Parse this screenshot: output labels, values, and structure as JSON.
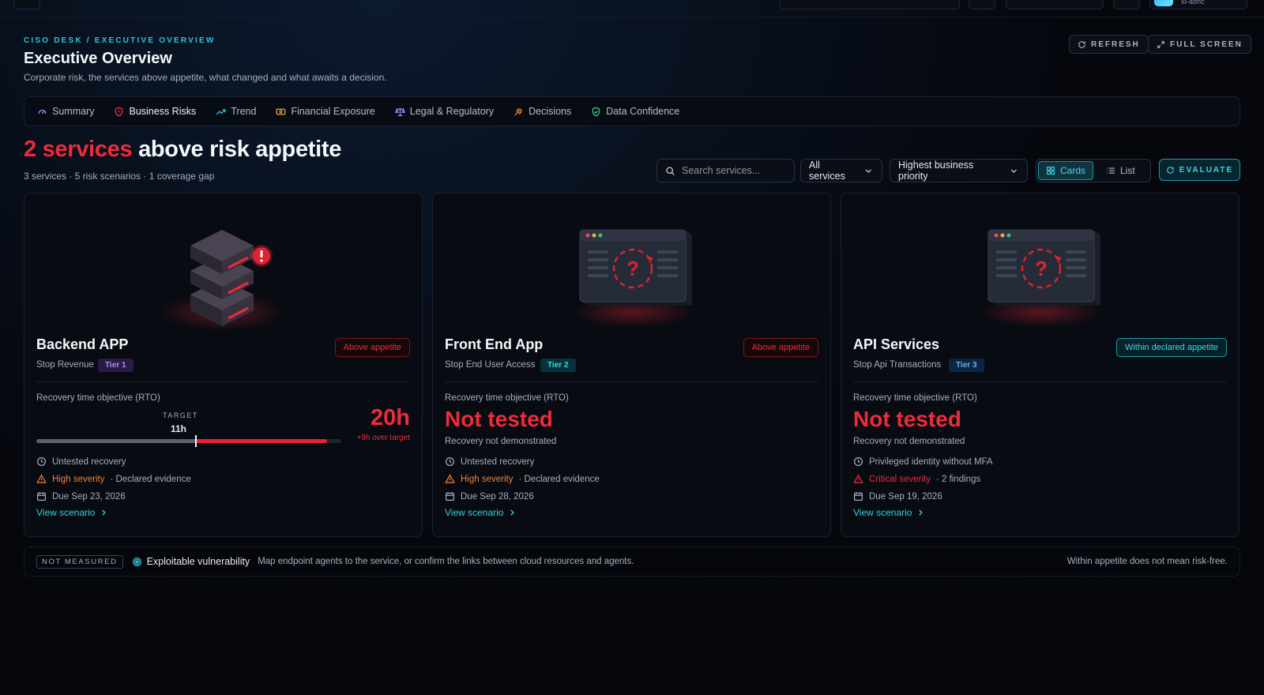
{
  "app": {
    "user_label": "xFabric"
  },
  "header": {
    "breadcrumb": "CISO DESK / EXECUTIVE OVERVIEW",
    "title": "Executive Overview",
    "subtitle": "Corporate risk, the services above appetite, what changed and what awaits a decision.",
    "refresh_label": "REFRESH",
    "fullscreen_label": "FULL SCREEN"
  },
  "tabs": [
    {
      "label": "Summary",
      "icon": "gauge-icon",
      "active": false
    },
    {
      "label": "Business Risks",
      "icon": "shield-alert-icon",
      "active": true
    },
    {
      "label": "Trend",
      "icon": "trend-up-icon",
      "active": false
    },
    {
      "label": "Financial Exposure",
      "icon": "banknote-icon",
      "active": false
    },
    {
      "label": "Legal & Regulatory",
      "icon": "scale-icon",
      "active": false
    },
    {
      "label": "Decisions",
      "icon": "gavel-icon",
      "active": false
    },
    {
      "label": "Data Confidence",
      "icon": "shield-check-icon",
      "active": false
    }
  ],
  "summary": {
    "headline_count": "2 services",
    "headline_rest": " above risk appetite",
    "subline": "3 services · 5 risk scenarios · 1 coverage gap"
  },
  "controls": {
    "search_placeholder": "Search services...",
    "filter_value": "All services",
    "sort_value": "Highest business priority",
    "view_cards": "Cards",
    "view_list": "List",
    "view_selected": "Cards",
    "evaluate_label": "EVALUATE"
  },
  "cards": [
    {
      "name": "Backend APP",
      "impact": "Stop Revenue",
      "tier": "Tier 1",
      "status": "Above appetite",
      "rto_label": "Recovery time objective (RTO)",
      "rto_target_label": "TARGET",
      "rto_target": "11h",
      "rto_value": "20h",
      "rto_over": "+9h over target",
      "rto_target_hours": 11,
      "rto_value_hours": 20,
      "meta1": "Untested recovery",
      "severity": "High severity",
      "severity_detail": "· Declared evidence",
      "due": "Due Sep 23, 2026",
      "link": "View scenario"
    },
    {
      "name": "Front End App",
      "impact": "Stop End User Access",
      "tier": "Tier 2",
      "status": "Above appetite",
      "rto_label": "Recovery time objective (RTO)",
      "rto_status": "Not tested",
      "rto_sub": "Recovery not demonstrated",
      "meta1": "Untested recovery",
      "severity": "High severity",
      "severity_detail": "· Declared evidence",
      "due": "Due Sep 28, 2026",
      "link": "View scenario"
    },
    {
      "name": "API Services",
      "impact": "Stop Api Transactions",
      "tier": "Tier 3",
      "status": "Within declared appetite",
      "rto_label": "Recovery time objective (RTO)",
      "rto_status": "Not tested",
      "rto_sub": "Recovery not demonstrated",
      "meta1": "Privileged identity without MFA",
      "severity": "Critical severity",
      "severity_detail": "· 2 findings",
      "due": "Due Sep 19, 2026",
      "link": "View scenario"
    }
  ],
  "coverage": {
    "tag": "NOT MEASURED",
    "name": "Exploitable vulnerability",
    "text": "Map endpoint agents to the service, or confirm the links between cloud resources and agents.",
    "note": "Within appetite does not mean risk-free."
  },
  "colors": {
    "accent": "#2ec5d6",
    "danger": "#ef2b3a",
    "warning": "#f2813a",
    "background": "#05070d"
  }
}
